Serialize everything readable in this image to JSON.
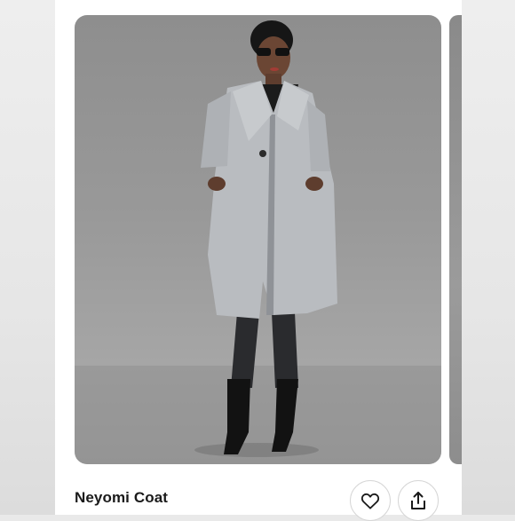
{
  "product": {
    "title": "Neyomi Coat"
  },
  "icons": {
    "like": "heart-icon",
    "share": "share-icon"
  },
  "colors": {
    "card_background": "#ffffff",
    "outer_background": "#e9e9e9",
    "coat": "#b9bcc0",
    "backdrop": "#959595"
  }
}
